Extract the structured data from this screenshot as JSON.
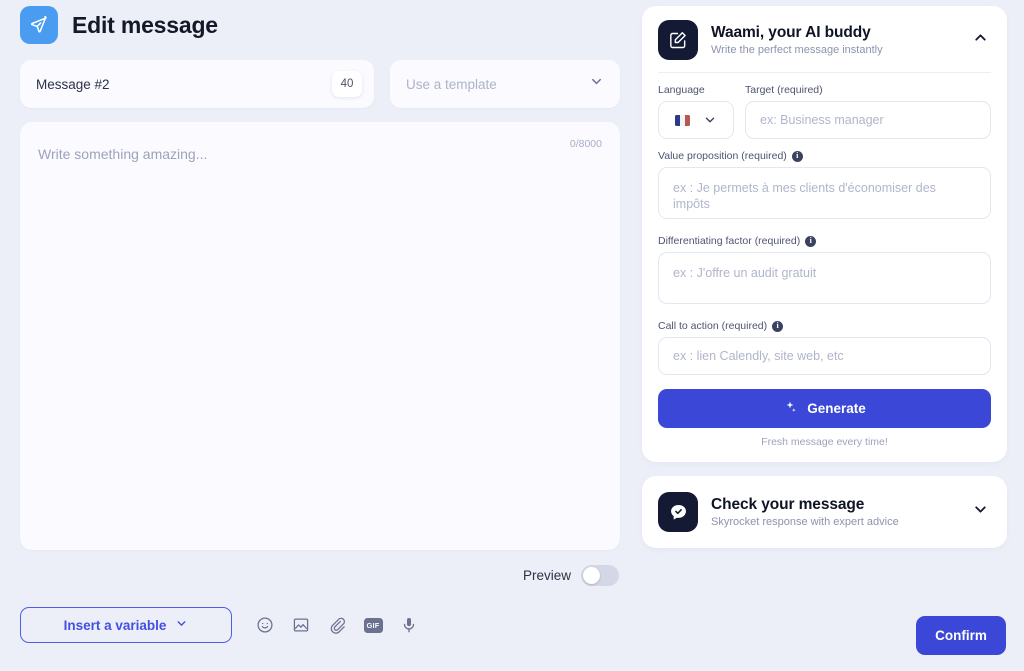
{
  "header": {
    "title": "Edit message",
    "icon": "send-plane-icon"
  },
  "message_meta": {
    "name": "Message #2",
    "count_badge": "40",
    "template_placeholder": "Use a template"
  },
  "editor": {
    "placeholder": "Write something amazing...",
    "char_count": "0/8000"
  },
  "preview": {
    "label": "Preview",
    "enabled": false
  },
  "toolbar": {
    "insert_variable_label": "Insert a variable",
    "icons": [
      {
        "name": "emoji-icon",
        "label": "emoji"
      },
      {
        "name": "image-icon",
        "label": "image"
      },
      {
        "name": "attachment-icon",
        "label": "attachment"
      },
      {
        "name": "gif-icon",
        "label": "GIF"
      },
      {
        "name": "microphone-icon",
        "label": "voice"
      }
    ]
  },
  "footer": {
    "confirm_label": "Confirm"
  },
  "ai_panel": {
    "title": "Waami, your AI buddy",
    "subtitle": "Write the perfect message instantly",
    "icon": "edit-square-icon",
    "chevron": "chevron-up-icon",
    "expanded": true,
    "language_label": "Language",
    "language_value": "fr",
    "target_label": "Target (required)",
    "target_placeholder": "ex: Business manager",
    "value_prop_label": "Value proposition (required)",
    "value_prop_placeholder": "ex : Je permets à mes clients d'économiser des impôts",
    "differentiating_label": "Differentiating factor (required)",
    "differentiating_placeholder": "ex : J'offre un audit gratuit",
    "cta_label": "Call to action (required)",
    "cta_placeholder": "ex : lien Calendly, site web, etc",
    "generate_label": "Generate",
    "generate_note": "Fresh message every time!"
  },
  "check_panel": {
    "title": "Check your message",
    "subtitle": "Skyrocket response with expert advice",
    "icon": "chat-check-icon",
    "chevron": "chevron-down-icon",
    "expanded": false
  },
  "colors": {
    "page_bg": "#edeff8",
    "accent": "#3b47d6",
    "accent_outline": "#4c5ee8",
    "panel_dark": "#141a33",
    "header_icon_bg": "#4a9cf0"
  }
}
